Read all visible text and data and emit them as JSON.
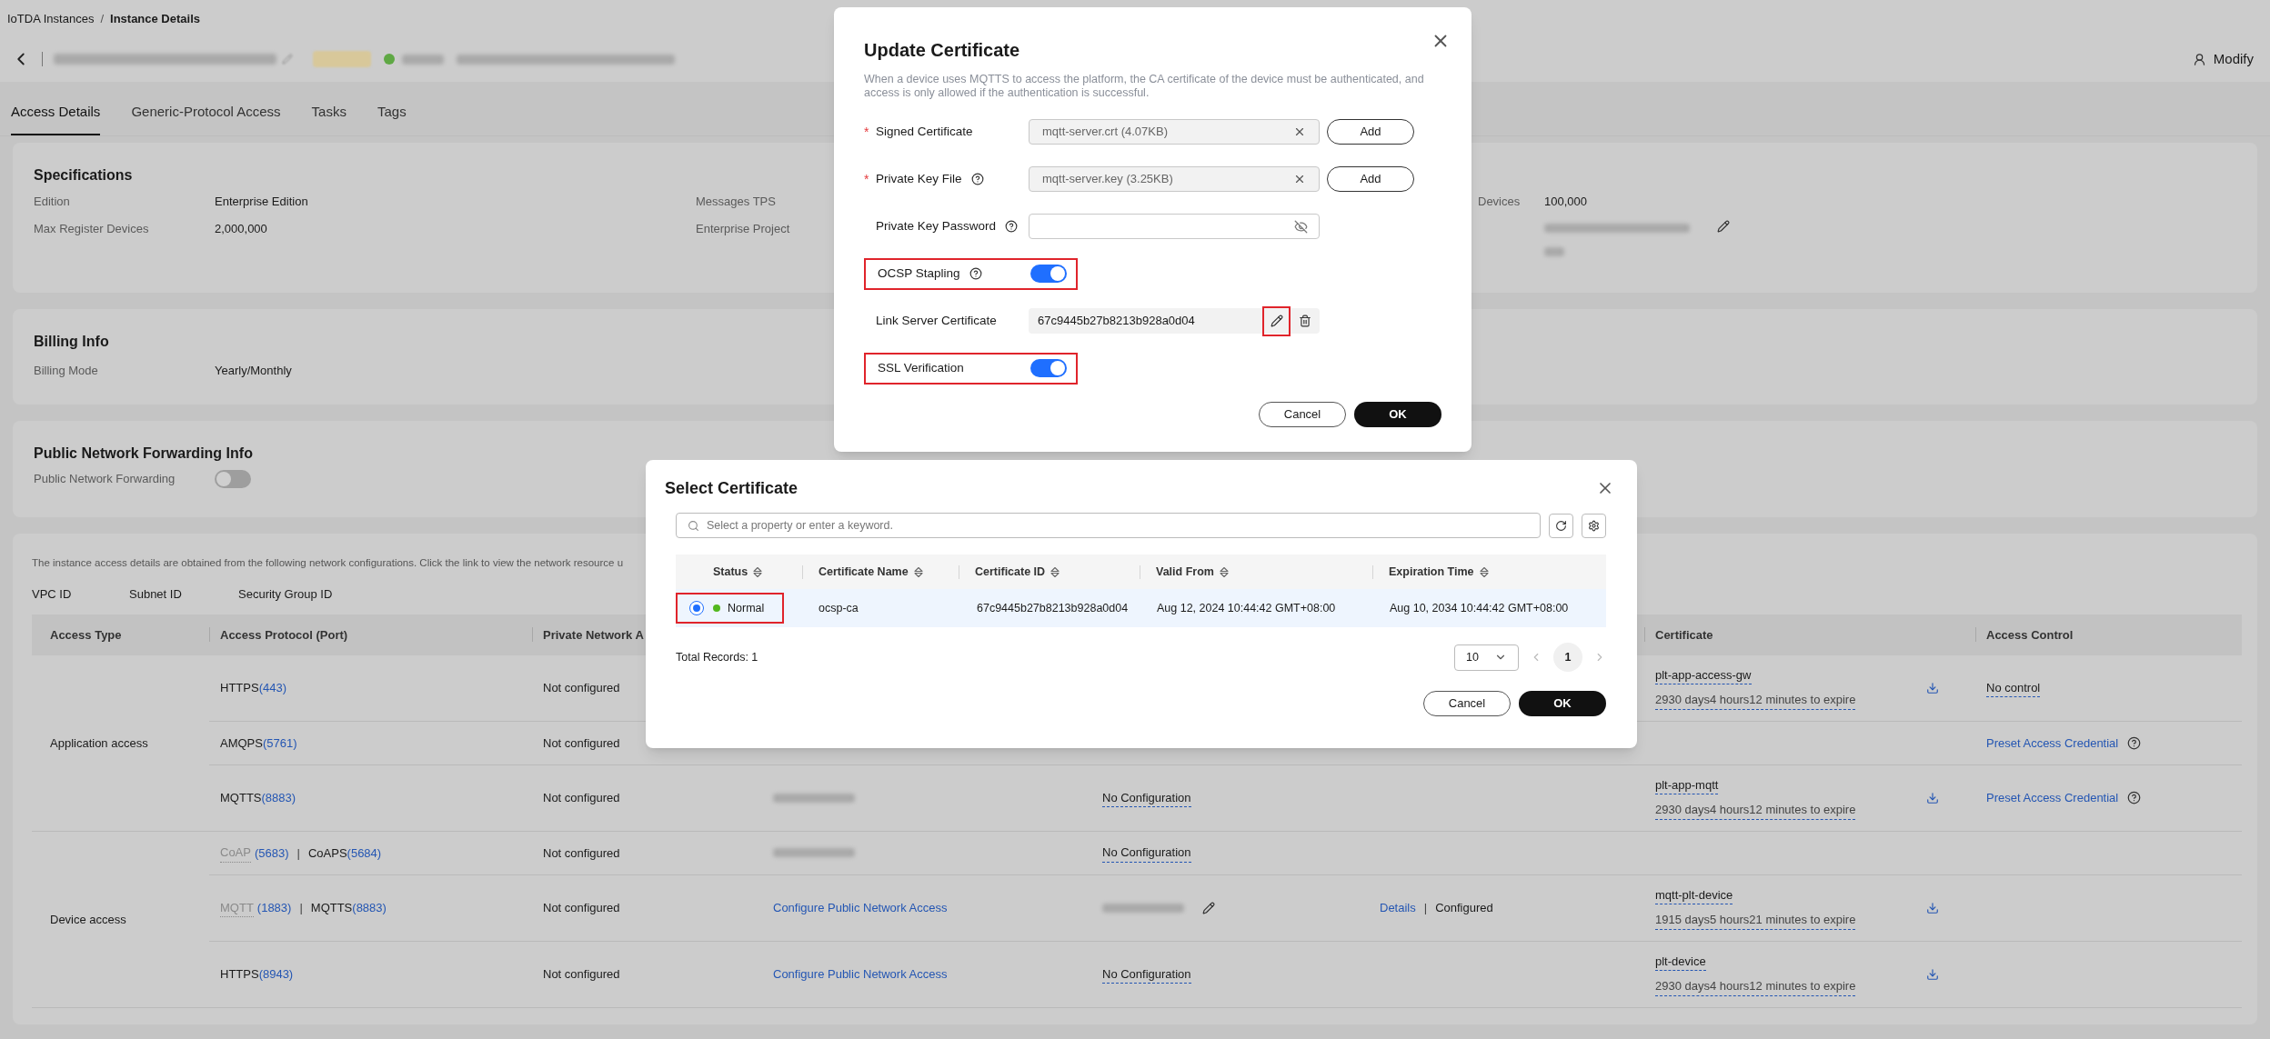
{
  "breadcrumb": {
    "items": [
      "IoTDA Instances",
      "Instance Details"
    ],
    "separator": "/"
  },
  "header": {
    "modify": "Modify"
  },
  "tabs": [
    {
      "label": "Access Details",
      "selected": true
    },
    {
      "label": "Generic-Protocol Access",
      "selected": false
    },
    {
      "label": "Tasks",
      "selected": false
    },
    {
      "label": "Tags",
      "selected": false
    }
  ],
  "specifications": {
    "title": "Specifications",
    "columns": [
      [
        {
          "label": "Edition",
          "value": "Enterprise Edition"
        },
        {
          "label": "Max Register Devices",
          "value": "2,000,000"
        }
      ],
      [
        {
          "label": "Messages TPS"
        },
        {
          "label": "Enterprise Project"
        }
      ],
      [
        {
          "label": "Devices",
          "value": "100,000"
        },
        {
          "blurred": true,
          "editable": true
        }
      ]
    ]
  },
  "billing": {
    "title": "Billing Info",
    "fields": [
      {
        "label": "Billing Mode",
        "value": "Yearly/Monthly"
      }
    ]
  },
  "forwarding": {
    "title": "Public Network Forwarding Info",
    "fields": [
      {
        "label": "Public Network Forwarding",
        "on": false
      }
    ]
  },
  "access": {
    "note": "The instance access details are obtained from the following network configurations. Click the link to view the network resource u",
    "network_labels": [
      "VPC ID",
      "Subnet ID",
      "Security Group ID"
    ],
    "columns": [
      "Access Type",
      "Access Protocol (Port)",
      "Private Network A",
      null,
      null,
      null,
      "Certificate",
      "Access Control"
    ],
    "groups": [
      {
        "type": "Application access",
        "rows": [
          {
            "cells": [
              [
                {
                  "kind": "text",
                  "text": "HTTPS"
                },
                {
                  "kind": "link",
                  "text": "(443)"
                }
              ],
              [
                {
                  "kind": "text",
                  "text": "Not configured"
                }
              ],
              [],
              [],
              [],
              [
                {
                  "kind": "cert",
                  "name": "plt-app-access-gw",
                  "expire": "2930 days4 hours12 minutes to expire"
                }
              ],
              [
                {
                  "kind": "dashed",
                  "text": "No control"
                }
              ]
            ]
          },
          {
            "cells": [
              [
                {
                  "kind": "text",
                  "text": "AMQPS"
                },
                {
                  "kind": "link",
                  "text": "(5761)"
                }
              ],
              [
                {
                  "kind": "text",
                  "text": "Not configured"
                }
              ],
              [],
              [],
              [],
              [],
              [
                {
                  "kind": "link",
                  "text": "Preset Access Credential"
                },
                {
                  "kind": "help"
                }
              ]
            ]
          },
          {
            "cells": [
              [
                {
                  "kind": "text",
                  "text": "MQTTS"
                },
                {
                  "kind": "link",
                  "text": "(8883)"
                }
              ],
              [
                {
                  "kind": "text",
                  "text": "Not configured"
                }
              ],
              [
                {
                  "kind": "redacted"
                }
              ],
              [
                {
                  "kind": "dashed",
                  "text": "No Configuration"
                }
              ],
              [],
              [
                {
                  "kind": "cert",
                  "name": "plt-app-mqtt",
                  "expire": "2930 days4 hours12 minutes to expire"
                }
              ],
              [
                {
                  "kind": "link",
                  "text": "Preset Access Credential"
                },
                {
                  "kind": "help"
                }
              ]
            ]
          }
        ]
      },
      {
        "type": "Device access",
        "rows": [
          {
            "cells": [
              [
                {
                  "kind": "muted",
                  "text": "CoAP"
                },
                {
                  "kind": "link",
                  "text": "(5683)"
                },
                {
                  "kind": "sep",
                  "text": "|"
                },
                {
                  "kind": "text",
                  "text": "CoAPS"
                },
                {
                  "kind": "link",
                  "text": "(5684)"
                }
              ],
              [
                {
                  "kind": "text",
                  "text": "Not configured"
                }
              ],
              [
                {
                  "kind": "redacted"
                }
              ],
              [
                {
                  "kind": "dashed",
                  "text": "No Configuration"
                }
              ],
              [],
              [],
              []
            ]
          },
          {
            "cells": [
              [
                {
                  "kind": "muted",
                  "text": "MQTT"
                },
                {
                  "kind": "link",
                  "text": "(1883)"
                },
                {
                  "kind": "sep",
                  "text": "|"
                },
                {
                  "kind": "text",
                  "text": "MQTTS"
                },
                {
                  "kind": "link",
                  "text": "(8883)"
                }
              ],
              [
                {
                  "kind": "text",
                  "text": "Not configured"
                }
              ],
              [
                {
                  "kind": "link",
                  "text": "Configure Public Network Access"
                }
              ],
              [
                {
                  "kind": "redacted"
                },
                {
                  "kind": "edit"
                }
              ],
              [
                {
                  "kind": "link",
                  "text": "Details"
                },
                {
                  "kind": "sep",
                  "text": "|"
                },
                {
                  "kind": "text",
                  "text": "Configured"
                }
              ],
              [
                {
                  "kind": "cert",
                  "name": "mqtt-plt-device",
                  "expire": "1915 days5 hours21 minutes to expire"
                }
              ],
              []
            ]
          },
          {
            "cells": [
              [
                {
                  "kind": "text",
                  "text": "HTTPS"
                },
                {
                  "kind": "link",
                  "text": "(8943)"
                }
              ],
              [
                {
                  "kind": "text",
                  "text": "Not configured"
                }
              ],
              [
                {
                  "kind": "link",
                  "text": "Configure Public Network Access"
                }
              ],
              [
                {
                  "kind": "dashed",
                  "text": "No Configuration"
                }
              ],
              [],
              [
                {
                  "kind": "cert",
                  "name": "plt-device",
                  "expire": "2930 days4 hours12 minutes to expire"
                }
              ],
              []
            ]
          }
        ]
      }
    ]
  },
  "update_dialog": {
    "title": "Update Certificate",
    "description": "When a device uses MQTTS to access the platform, the CA certificate of the device must be authenticated, and access is only allowed if the authentication is successful.",
    "fields": [
      {
        "kind": "file",
        "label": "Signed Certificate",
        "required": true,
        "help": false,
        "value": "mqtt-server.crt (4.07KB)",
        "button": "Add"
      },
      {
        "kind": "file",
        "label": "Private Key File",
        "required": true,
        "help": true,
        "value": "mqtt-server.key (3.25KB)",
        "button": "Add"
      },
      {
        "kind": "password",
        "label": "Private Key Password",
        "required": false,
        "help": true
      },
      {
        "kind": "switch",
        "label": "OCSP Stapling",
        "required": false,
        "help": true,
        "on": true,
        "highlighted": true
      },
      {
        "kind": "linked",
        "label": "Link Server Certificate",
        "required": false,
        "help": false,
        "value": "67c9445b27b8213b928a0d04",
        "highlighted": true
      },
      {
        "kind": "switch",
        "label": "SSL Verification",
        "required": false,
        "help": false,
        "on": true,
        "highlighted": true
      }
    ],
    "required_mark": "*",
    "cancel": "Cancel",
    "ok": "OK"
  },
  "select_dialog": {
    "title": "Select Certificate",
    "search_placeholder": "Select a property or enter a keyword.",
    "columns": [
      "Status",
      "Certificate Name",
      "Certificate ID",
      "Valid From",
      "Expiration Time"
    ],
    "rows": [
      {
        "selected": true,
        "highlighted": true,
        "status": "Normal",
        "name": "ocsp-ca",
        "id": "67c9445b27b8213b928a0d04",
        "valid_from": "Aug 12, 2024 10:44:42 GMT+08:00",
        "expires": "Aug 10, 2034 10:44:42 GMT+08:00"
      }
    ],
    "total": "Total Records: 1",
    "page_size": "10",
    "pages": [
      {
        "label": "1",
        "selected": true
      }
    ],
    "cancel": "Cancel",
    "ok": "OK"
  }
}
